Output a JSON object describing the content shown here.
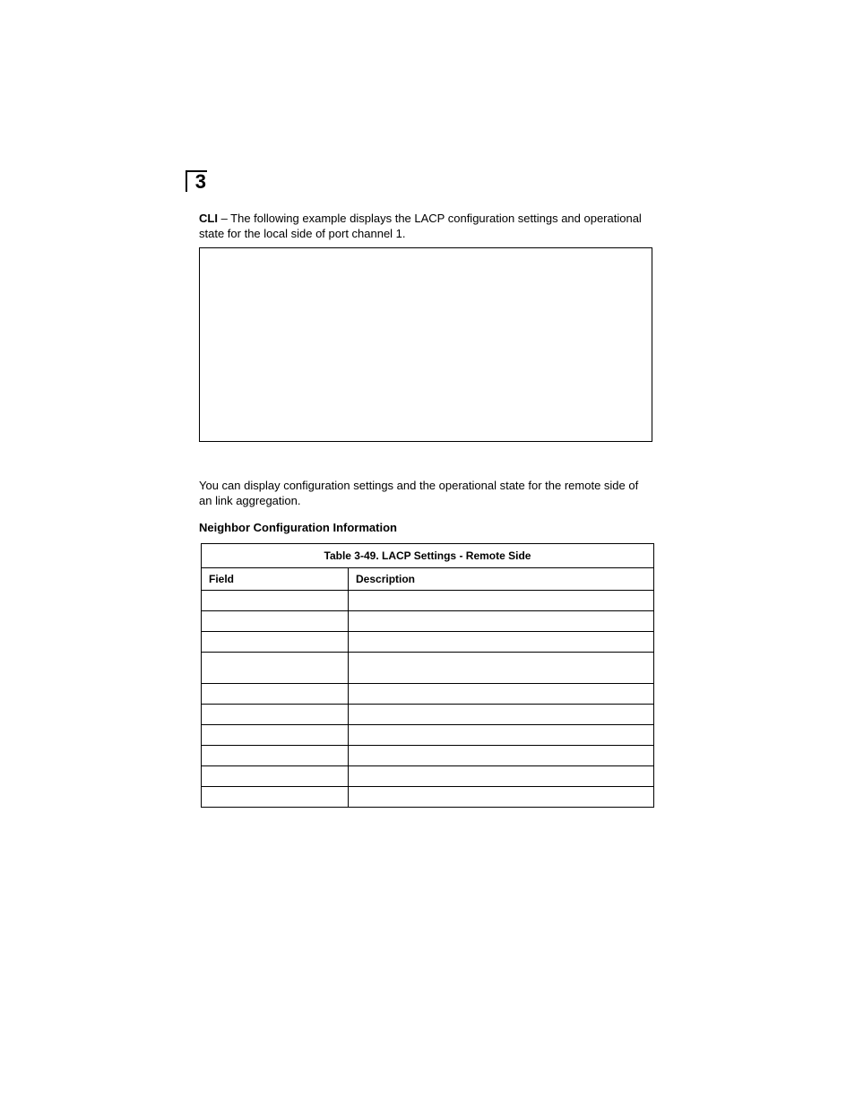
{
  "chapter_number": "3",
  "intro": {
    "bold": "CLI",
    "rest": " – The following example displays the LACP configuration settings and operational state for the local side of port channel 1."
  },
  "para2": "You can display configuration settings and the operational state for the remote side of an link aggregation.",
  "heading": "Neighbor Configuration Information",
  "table": {
    "caption": "Table 3-49.  LACP Settings - Remote Side",
    "col_field": "Field",
    "col_desc": "Description",
    "rows": [
      {
        "field": "",
        "desc": "",
        "tall": false
      },
      {
        "field": "",
        "desc": "",
        "tall": false
      },
      {
        "field": "",
        "desc": "",
        "tall": false
      },
      {
        "field": "",
        "desc": "",
        "tall": true
      },
      {
        "field": "",
        "desc": "",
        "tall": false
      },
      {
        "field": "",
        "desc": "",
        "tall": false
      },
      {
        "field": "",
        "desc": "",
        "tall": false
      },
      {
        "field": "",
        "desc": "",
        "tall": false
      },
      {
        "field": "",
        "desc": "",
        "tall": false
      },
      {
        "field": "",
        "desc": "",
        "tall": false
      }
    ]
  }
}
